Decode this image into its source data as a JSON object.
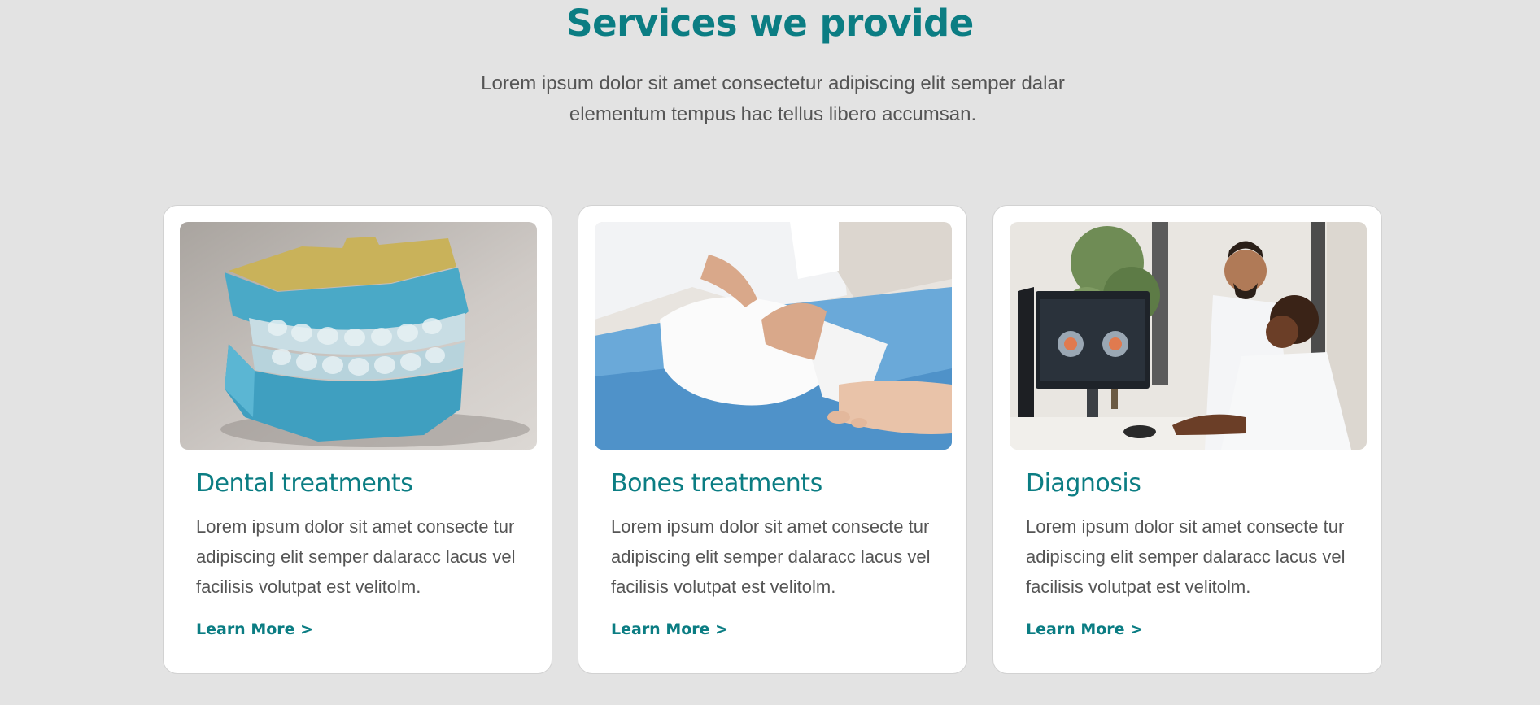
{
  "header": {
    "title": "Services we provide",
    "subtitle": "Lorem ipsum dolor sit amet consectetur adipiscing elit semper dalar elementum tempus hac tellus libero accumsan."
  },
  "colors": {
    "accent": "#0b7d83",
    "background": "#e3e3e3",
    "card": "#ffffff",
    "body_text": "#555555"
  },
  "cards": [
    {
      "title": "Dental treatments",
      "text": "Lorem ipsum dolor sit amet consecte tur adipiscing elit semper dalaracc lacus vel facilisis volutpat est velitolm.",
      "link": "Learn More >",
      "image": "dental-model-photo"
    },
    {
      "title": "Bones treatments",
      "text": "Lorem ipsum dolor sit amet consecte tur adipiscing elit semper dalaracc lacus vel facilisis volutpat est velitolm.",
      "link": "Learn More >",
      "image": "leg-cast-photo"
    },
    {
      "title": "Diagnosis",
      "text": "Lorem ipsum dolor sit amet consecte tur adipiscing elit semper dalaracc lacus vel facilisis volutpat est velitolm.",
      "link": "Learn More >",
      "image": "doctors-monitor-photo"
    }
  ]
}
